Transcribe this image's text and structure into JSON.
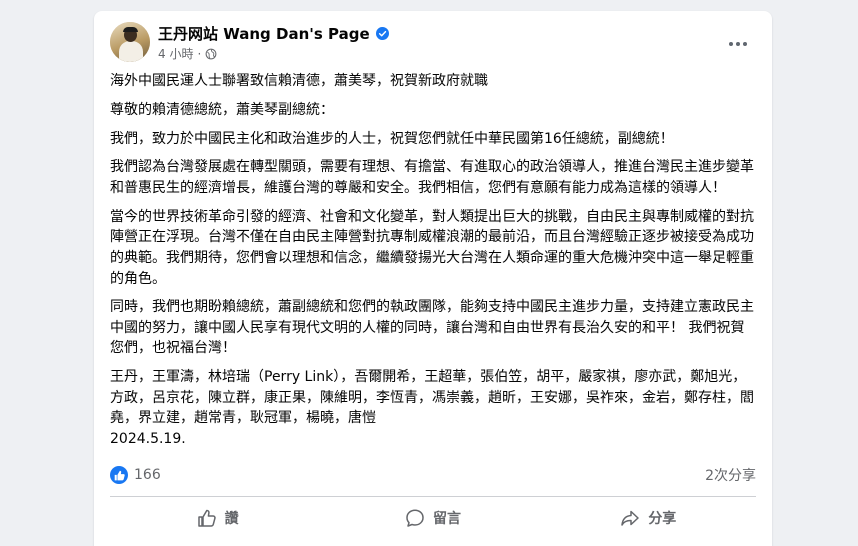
{
  "post": {
    "page_name": "王丹网站 Wang Dan's Page",
    "time": "4 小時",
    "separator": "·",
    "paragraphs": [
      "海外中國民運人士聯署致信賴清德，蕭美琴，祝賀新政府就職",
      "尊敬的賴清德總統，蕭美琴副總統：",
      "我們，致力於中國民主化和政治進步的人士，祝賀您們就任中華民國第16任總統，副總統！",
      "我們認為台灣發展處在轉型關頭，需要有理想、有擔當、有進取心的政治領導人，推進台灣民主進步變革和普惠民生的經濟增長，維護台灣的尊嚴和安全。我們相信，您們有意願有能力成為這樣的領導人！",
      "當今的世界技術革命引發的經濟、社會和文化變革，對人類提出巨大的挑戰，自由民主與專制威權的對抗陣營正在浮現。台灣不僅在自由民主陣營對抗專制威權浪潮的最前沿，而且台灣經驗正逐步被接受為成功的典範。我們期待，您們會以理想和信念，繼續發揚光大台灣在人類命運的重大危機沖突中這一舉足輕重的角色。",
      "同時，我們也期盼賴總統，蕭副總統和您們的執政團隊，能夠支持中國民主進步力量，支持建立憲政民主中國的努力，讓中國人民享有現代文明的人權的同時，讓台灣和自由世界有長治久安的和平！ 我們祝賀您們，也祝福台灣！",
      "王丹，王軍濤，林培瑞（Perry Link），吾爾開希，王超華，張伯笠，胡平，嚴家祺，廖亦武，鄭旭光，方政，呂京花，陳立群，康正果，陳維明，李恆青，馮崇義，趙昕，王安娜，吳祚來，金岩，鄭存柱，閻堯，界立建，趙常青，耿冠軍，楊曉，唐愷\n2024.5.19."
    ]
  },
  "stats": {
    "reaction_count": "166",
    "shares": "2次分享"
  },
  "actions": {
    "like": "讚",
    "comment": "留言",
    "share": "分享"
  },
  "colors": {
    "accent": "#1877f2",
    "secondary_text": "#65676b",
    "background": "#eef0f3"
  },
  "icons": {
    "verified": "verified-badge-icon",
    "audience": "globe-icon",
    "more": "more-options-icon",
    "like": "thumbs-up-icon",
    "comment": "speech-bubble-icon",
    "share": "share-arrow-icon"
  }
}
